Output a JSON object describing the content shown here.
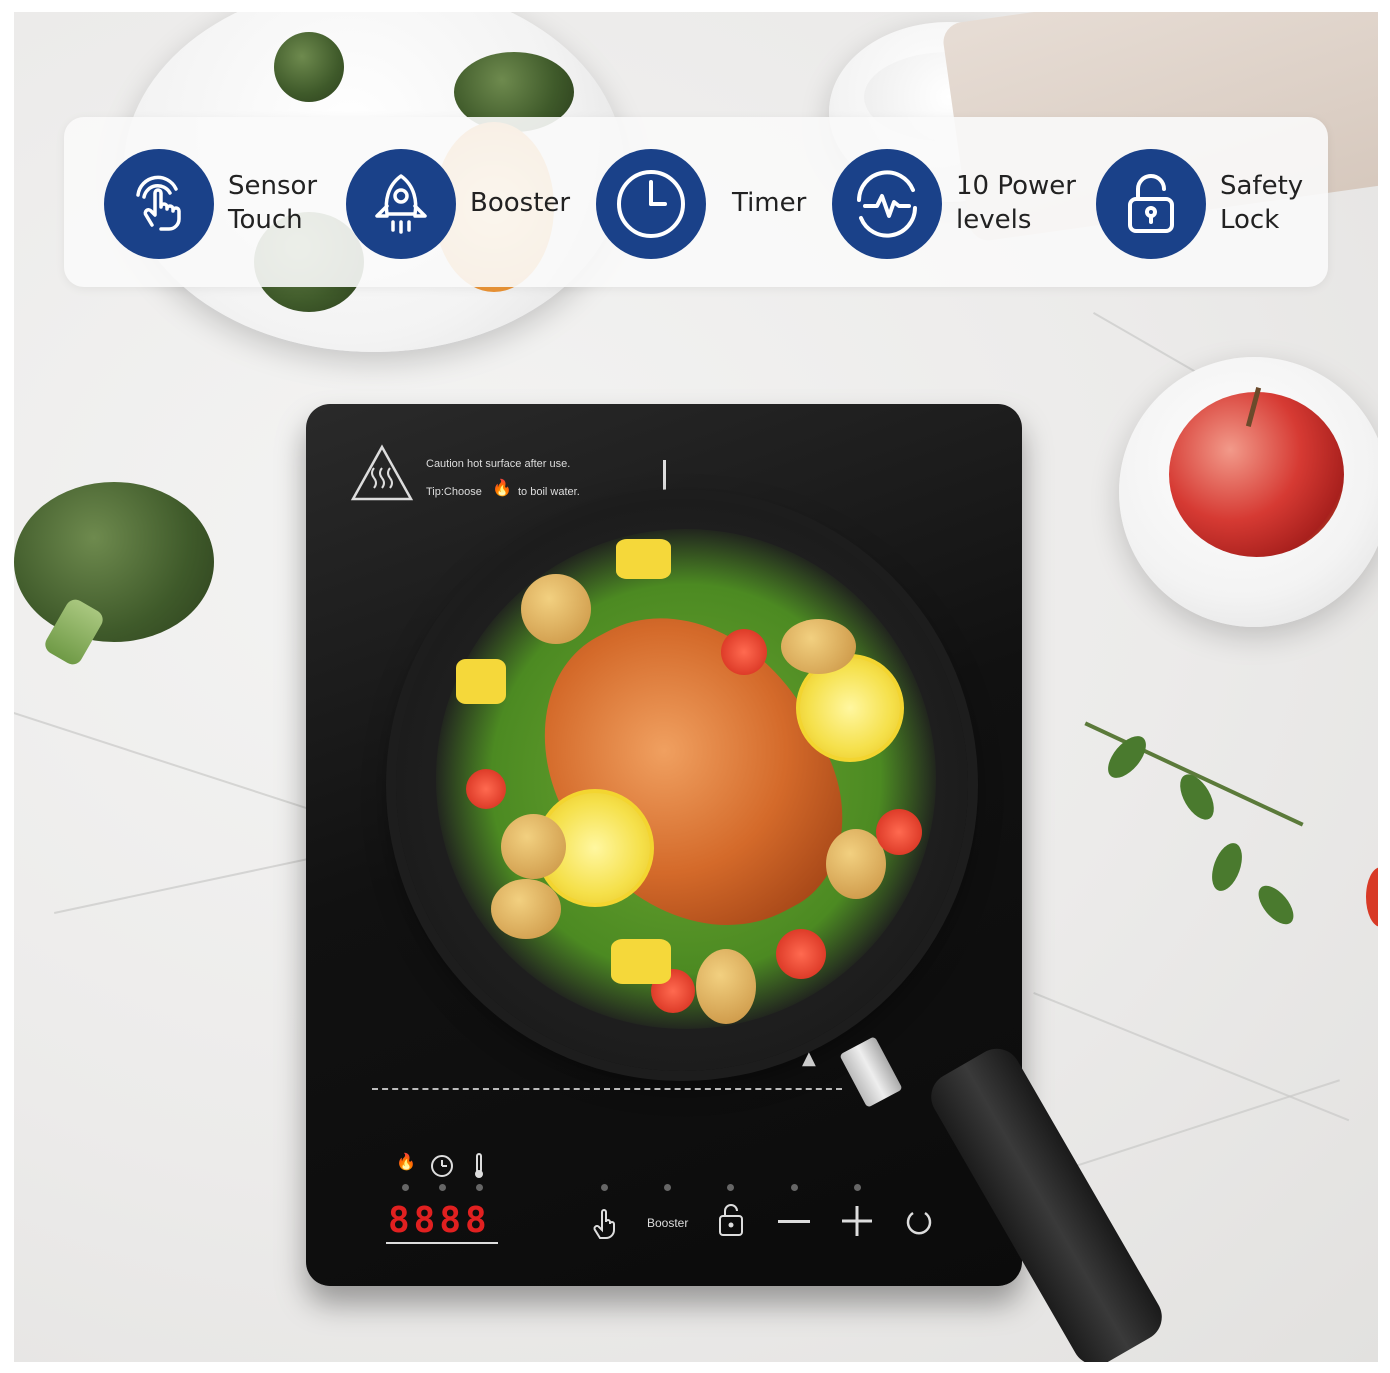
{
  "features": [
    {
      "label": "Sensor\nTouch",
      "icon": "finger-touch-icon"
    },
    {
      "label": "Booster",
      "icon": "rocket-icon"
    },
    {
      "label": "Timer",
      "icon": "clock-icon"
    },
    {
      "label": "10 Power\nlevels",
      "icon": "pulse-icon"
    },
    {
      "label": "Safety\nLock",
      "icon": "padlock-icon"
    }
  ],
  "hob": {
    "caution_line1": "Caution hot surface after use.",
    "caution_tip_prefix": "Tip:Choose",
    "caution_tip_suffix": "to boil water.",
    "display": "8888",
    "booster_label": "Booster"
  },
  "colors": {
    "accent": "#1a4189",
    "display": "#e12020"
  }
}
